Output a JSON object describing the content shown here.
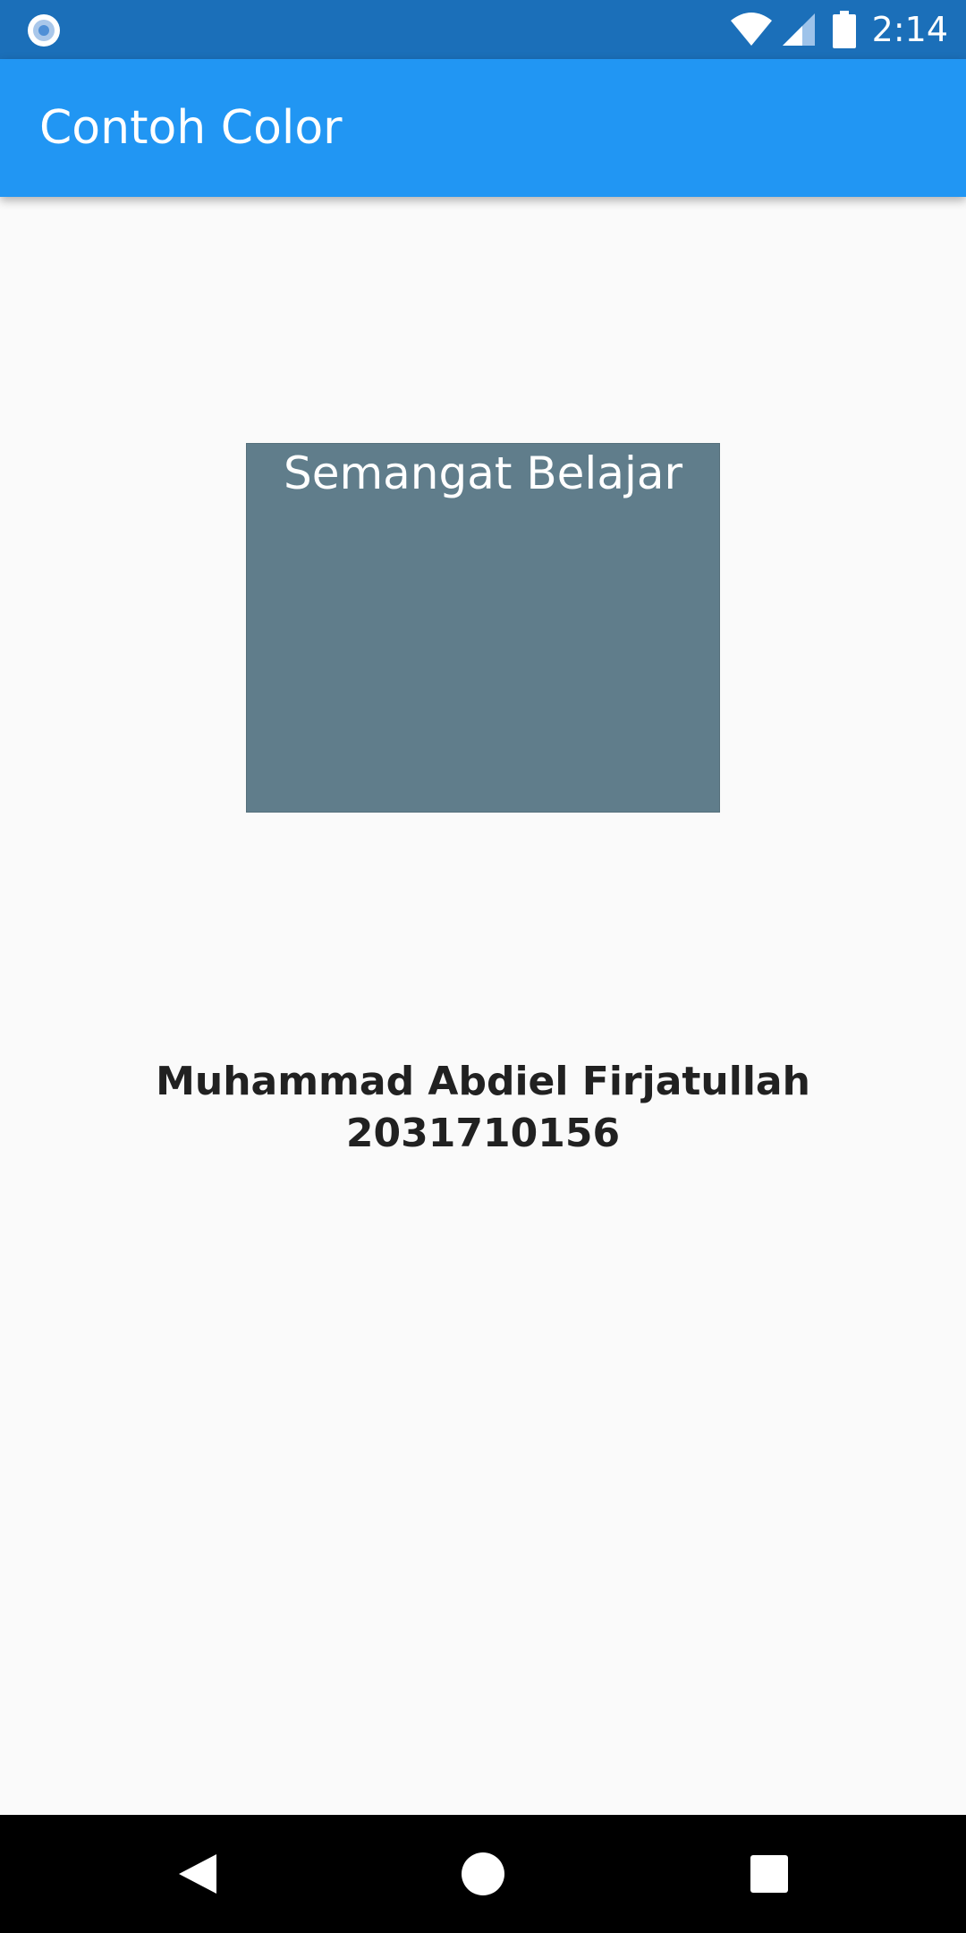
{
  "status_bar": {
    "time": "2:14",
    "icons": [
      "app-notification-icon",
      "wifi-icon",
      "signal-icon",
      "battery-icon"
    ]
  },
  "app_bar": {
    "title": "Contoh Color",
    "color": "#2196f3"
  },
  "color_box": {
    "text": "Semangat Belajar",
    "color": "#607d8b"
  },
  "identity": {
    "name": "Muhammad Abdiel Firjatullah",
    "id": "2031710156"
  },
  "nav_bar": {
    "buttons": [
      "back-icon",
      "home-icon",
      "recents-icon"
    ]
  },
  "colors": {
    "status_bar": "#1b6fb9",
    "background": "#fafafa",
    "text_dark": "#212121"
  }
}
